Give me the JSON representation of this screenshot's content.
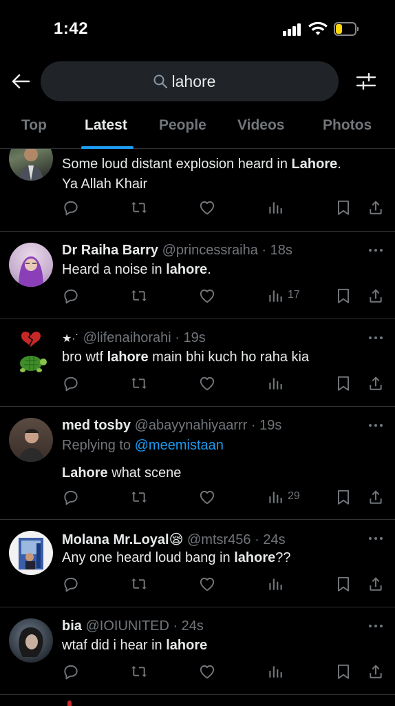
{
  "status_bar": {
    "time": "1:42",
    "battery_level": 0.35
  },
  "search": {
    "query": "lahore"
  },
  "tabs": [
    {
      "label": "Top"
    },
    {
      "label": "Latest",
      "active": true
    },
    {
      "label": "People"
    },
    {
      "label": "Videos"
    },
    {
      "label": "Photos"
    }
  ],
  "tweets": [
    {
      "name": "",
      "handle": "",
      "text_line1_pre": "Some loud distant explosion heard in ",
      "text_line1_bold": "Lahore",
      "text_line1_post": ".",
      "text_line2": "Ya Allah Khair",
      "views": ""
    },
    {
      "name": "Dr Raiha Barry",
      "handle": "@princessraiha · 18s",
      "text_pre": "Heard a noise in ",
      "text_bold": "lahore",
      "text_post": ".",
      "views": "17"
    },
    {
      "name": "★·˙",
      "handle": "@lifenaihorahi · 19s",
      "text_pre": "bro wtf ",
      "text_bold": "lahore",
      "text_post": " main bhi kuch ho raha kia",
      "views": ""
    },
    {
      "name": "med tosby",
      "handle": "@abayynahiyaarrr · 19s",
      "replying_label": "Replying to ",
      "replying_to": "@meemistaan",
      "text_bold": "Lahore",
      "text_post": " what scene",
      "views": "29"
    },
    {
      "name": "Molana Mr.Loyal😪",
      "handle": "@mtsr456 · 24s",
      "text_pre": "Any one heard loud bang in ",
      "text_bold": "lahore",
      "text_post": "??",
      "views": ""
    },
    {
      "name": "bia",
      "handle": "@IOIUNITED · 24s",
      "text_pre": "wtaf did i hear in ",
      "text_bold": "lahore",
      "text_post": "",
      "views": ""
    }
  ],
  "colors": {
    "background": "#000000",
    "text": "#e7e9ea",
    "muted": "#71767b",
    "accent": "#1d9bf0",
    "search_bg": "#202327",
    "divider": "#2f3336",
    "battery": "#ffd60a"
  },
  "icons": {
    "back": "arrow-left-icon",
    "search": "magnifier-icon",
    "filter": "sliders-icon",
    "reply": "reply-icon",
    "retweet": "retweet-icon",
    "like": "heart-icon",
    "views": "views-icon",
    "bookmark": "bookmark-icon",
    "share": "share-icon",
    "more": "more-icon"
  }
}
